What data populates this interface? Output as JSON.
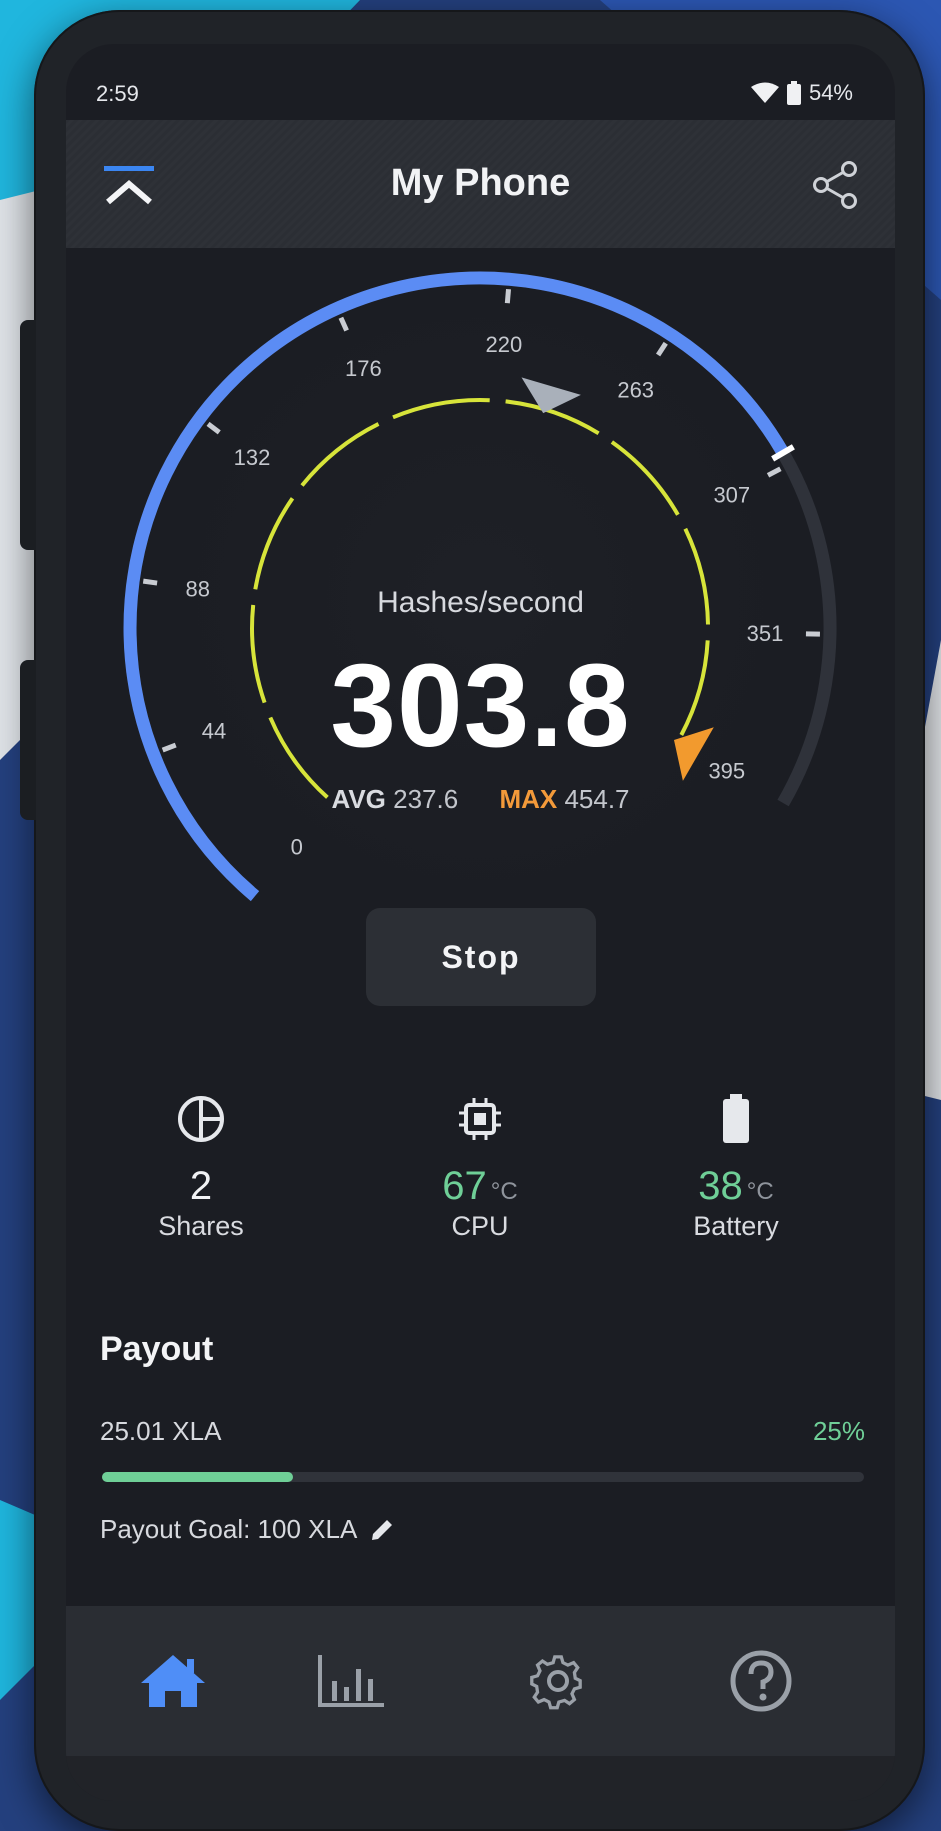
{
  "status": {
    "time": "2:59",
    "battery": "54%"
  },
  "appbar": {
    "title": "My Phone"
  },
  "gauge": {
    "unit_label": "Hashes/second",
    "value": "303.8",
    "value_num": 303.8,
    "min": 0,
    "max": 395,
    "avg_label": "AVG",
    "avg_value": "237.6",
    "avg_num": 237.6,
    "max_label": "MAX",
    "max_value": "454.7",
    "ticks": [
      "0",
      "44",
      "88",
      "132",
      "176",
      "220",
      "263",
      "307",
      "351",
      "395"
    ],
    "colors": {
      "progress": "#5b8cf4",
      "track": "#2f323a",
      "inner_ring": "#d7e43a",
      "avg_marker": "#a9b0ba",
      "max_marker": "#f29a2e"
    }
  },
  "stop_button": {
    "label": "Stop"
  },
  "metrics": [
    {
      "icon": "pie-chart-icon",
      "value": "2",
      "unit": "",
      "label": "Shares"
    },
    {
      "icon": "cpu-chip-icon",
      "value": "67",
      "unit": "°C",
      "label": "CPU"
    },
    {
      "icon": "battery-icon",
      "value": "38",
      "unit": "°C",
      "label": "Battery"
    }
  ],
  "payout": {
    "heading": "Payout",
    "amount": "25.01 XLA",
    "percent": "25%",
    "progress": 0.25,
    "goal": "Payout Goal:  100 XLA"
  },
  "nav": [
    {
      "icon": "home-icon",
      "active": true
    },
    {
      "icon": "stats-icon",
      "active": false
    },
    {
      "icon": "settings-gear-icon",
      "active": false
    },
    {
      "icon": "help-icon",
      "active": false
    }
  ],
  "theme": {
    "accent": "#5b8cf4",
    "green": "#6fcf97",
    "orange": "#f39a3a"
  }
}
